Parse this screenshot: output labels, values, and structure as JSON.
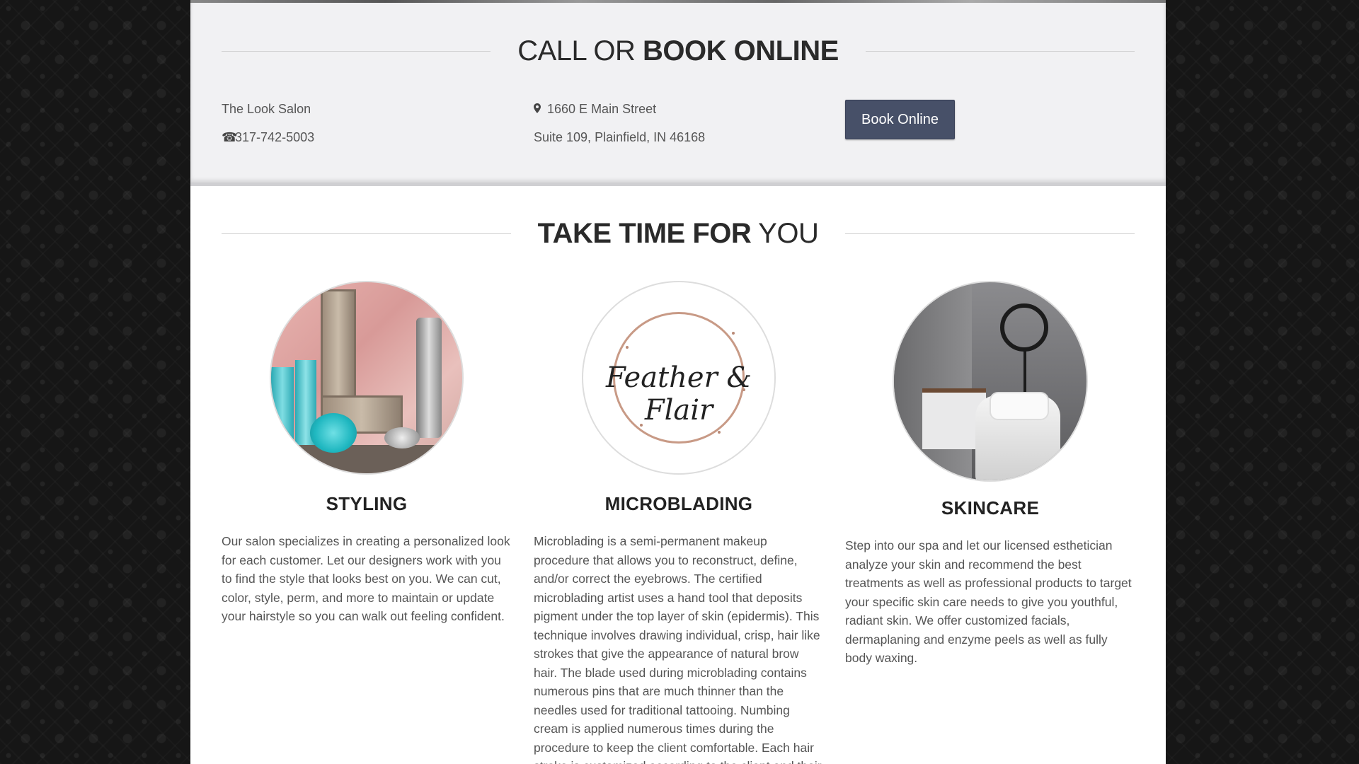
{
  "call_section": {
    "heading_light": "CALL OR ",
    "heading_bold": "BOOK ONLINE",
    "salon_name": "The Look Salon",
    "phone_icon": "phone-icon",
    "phone": "317-742-5003",
    "address_icon": "map-marker-icon",
    "address_line1": "1660 E Main Street",
    "address_line2": "Suite 109, Plainfield, IN 46168",
    "book_button": "Book Online"
  },
  "services_section": {
    "heading_bold": "TAKE TIME FOR",
    "heading_light": " YOU",
    "items": [
      {
        "title": "STYLING",
        "image": "hair-products-photo",
        "description": "Our salon specializes in creating a personalized look for each customer. Let our designers work with you to find the style that looks best on you. We can cut, color, style, perm, and more to maintain or update your hairstyle so you can walk out feeling confident."
      },
      {
        "title": "MICROBLADING",
        "image": "feather-and-flair-logo",
        "logo_text": "Feather & Flair",
        "description": "Microblading is a semi-permanent makeup procedure that allows you to reconstruct, define, and/or correct the eyebrows. The certified microblading artist uses a hand tool that deposits pigment under the top layer of skin (epidermis). This technique involves drawing individual, crisp, hair like strokes that give the appearance of natural brow hair. The blade used during microblading contains numerous pins that are much thinner than the needles used for traditional tattooing. Numbing cream is applied numerous times during the procedure to keep the client comfortable. Each hair stroke is customized according to the client and their"
      },
      {
        "title": "SKINCARE",
        "image": "spa-room-photo",
        "description": "Step into our spa and let our licensed esthetician analyze your skin and recommend the best treatments as well as professional products to target your specific skin care needs to give you youthful, radiant skin. We offer customized facials, dermaplaning and enzyme peels as well as fully body waxing."
      }
    ]
  }
}
